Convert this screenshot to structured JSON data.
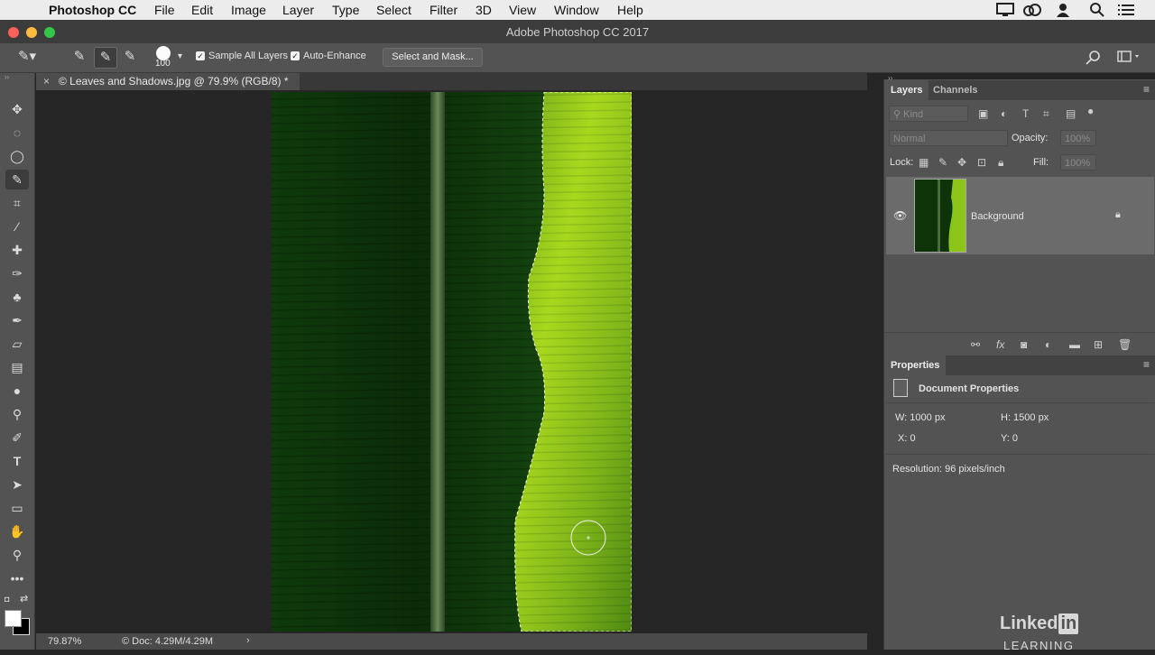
{
  "menubar": {
    "app_name": "Photoshop CC",
    "items": [
      "File",
      "Edit",
      "Image",
      "Layer",
      "Type",
      "Select",
      "Filter",
      "3D",
      "View",
      "Window",
      "Help"
    ]
  },
  "window": {
    "title": "Adobe Photoshop CC 2017"
  },
  "options": {
    "brush_size": "100",
    "sample_all_layers": "Sample All Layers",
    "auto_enhance": "Auto-Enhance",
    "select_and_mask": "Select and Mask..."
  },
  "document": {
    "tab_title": "© Leaves and Shadows.jpg @ 79.9% (RGB/8) *"
  },
  "status": {
    "zoom": "79.87%",
    "doc": "© Doc: 4.29M/4.29M"
  },
  "layers_panel": {
    "tabs": [
      "Layers",
      "Channels"
    ],
    "kind_placeholder": "Kind",
    "blend_mode": "Normal",
    "opacity_label": "Opacity:",
    "opacity_value": "100%",
    "lock_label": "Lock:",
    "fill_label": "Fill:",
    "fill_value": "100%",
    "layer_name": "Background"
  },
  "properties_panel": {
    "tab": "Properties",
    "section": "Document Properties",
    "w": "W:  1000 px",
    "h": "H:  1500 px",
    "x": "X:  0",
    "y": "Y:  0",
    "resolution": "Resolution: 96 pixels/inch"
  },
  "watermark": {
    "brand": "Linked",
    "brand_in": "in",
    "learning": "LEARNING"
  },
  "colors": {
    "ui_dark": "#535353",
    "leaf_dark": "#0d2e09",
    "leaf_bright": "#a8d81e"
  }
}
